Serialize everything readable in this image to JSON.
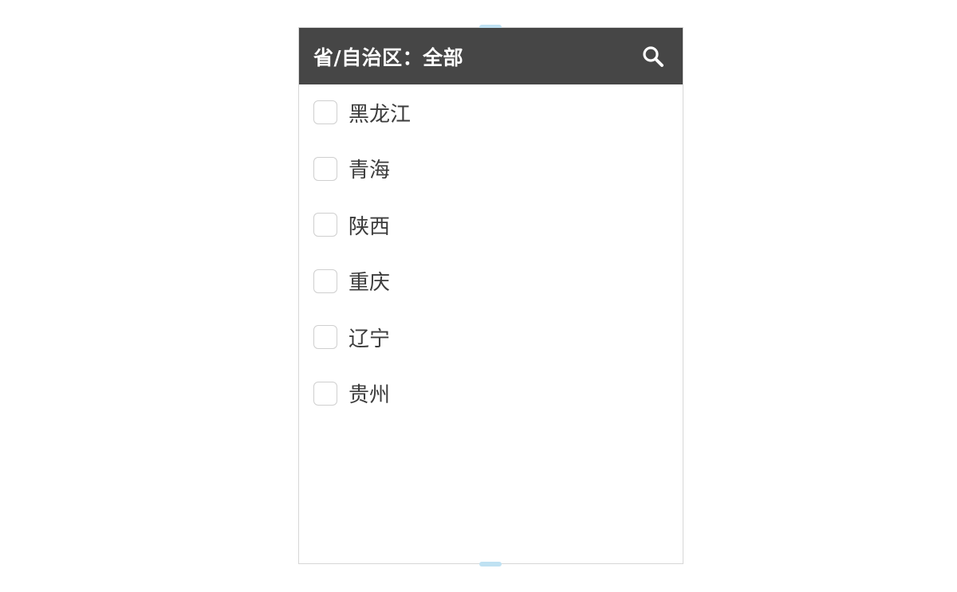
{
  "header": {
    "title": "省/自治区：全部",
    "search_icon": "search-icon"
  },
  "provinces": [
    {
      "label": "黑龙江",
      "checked": false
    },
    {
      "label": "青海",
      "checked": false
    },
    {
      "label": "陕西",
      "checked": false
    },
    {
      "label": "重庆",
      "checked": false
    },
    {
      "label": "辽宁",
      "checked": false
    },
    {
      "label": "贵州",
      "checked": false
    }
  ],
  "colors": {
    "header_bg": "#464646",
    "header_text": "#ffffff",
    "item_text": "#3c3c3c",
    "checkbox_border": "#cfcfcf",
    "resize_handle": "#bfe1f2"
  }
}
